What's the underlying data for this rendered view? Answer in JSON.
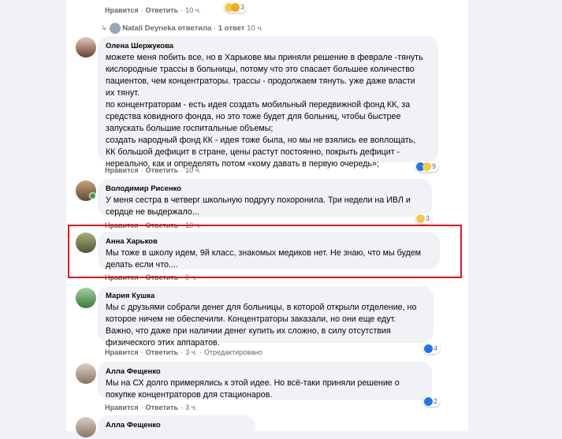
{
  "top": {
    "like_label": "Нравится",
    "reply_label": "Ответить",
    "time": "10 ч.",
    "reaction_count": "3"
  },
  "reply_thread": {
    "text": "Natali Deyneka ответила",
    "count": "1 ответ",
    "time": "10 ч."
  },
  "comments": [
    {
      "author": "Олена Шержукова",
      "text": "можете меня побить все, но в Харькове мы приняли решение в феврале -тянуть\nкислородные трассы в больницы, потому что это спасает большее количество\nпациентов, чем концентраторы. трассы - продолжаем тянуть. уже даже власти\nих тянут.\nпо концентраторам - есть идея создать мобильный передвижной фонд КК, за\nсредства ковидного фонда, но это тоже будет для больниц, чтобы быстрее\nзапускать большие госпитальные объемы;\nсоздать народный фонд КК - идея тоже была, но мы не взялись ее воплощать,\nКК большой дефицит в стране, цены растут постоянно, покрыть дефицит -\nнереально, как и определять потом «кому давать в первую очередь»;",
      "like_label": "Нравится",
      "reply_label": "Ответить",
      "time": "10 ч.",
      "reactions": "9"
    },
    {
      "author": "Володимир Рисенко",
      "text": "У меня сестра в четверг школьную подругу похоронила. Три недели на ИВЛ и\nсердце не выдержало...",
      "like_label": "Нравится",
      "reply_label": "Ответить",
      "time": "10 ч.",
      "reactions": "3"
    },
    {
      "author": "Анна Харьков",
      "text": "Мы тоже в школу идем, 9й класс, знакомых медиков нет. Не знаю, что мы будем\nделать если что....",
      "like_label": "Нравится",
      "reply_label": "Ответить",
      "time": "9 ч."
    },
    {
      "author": "Мария Кушка",
      "text": "Мы с друзьями собрали денег для больницы, в которой открыли отделение, но\nкоторое ничем не обеспечили. Концентраторы заказали, но они еще едут.\nВажно, что даже при наличии денег купить их сложно, в силу отсутствия\nфизического этих аппаратов.",
      "like_label": "Нравится",
      "reply_label": "Ответить",
      "time": "3 ч.",
      "edited": "Отредактировано",
      "reactions": "4"
    },
    {
      "author": "Алла Фещенко",
      "text": "Мы на СХ долго примерялись к этой идее. Но всё-таки приняли решение о\nпокупке концентраторов для стационаров.",
      "like_label": "Нравится",
      "reply_label": "Ответить",
      "time": "3 ч.",
      "reactions": "2"
    },
    {
      "author": "Алла Фещенко"
    }
  ]
}
